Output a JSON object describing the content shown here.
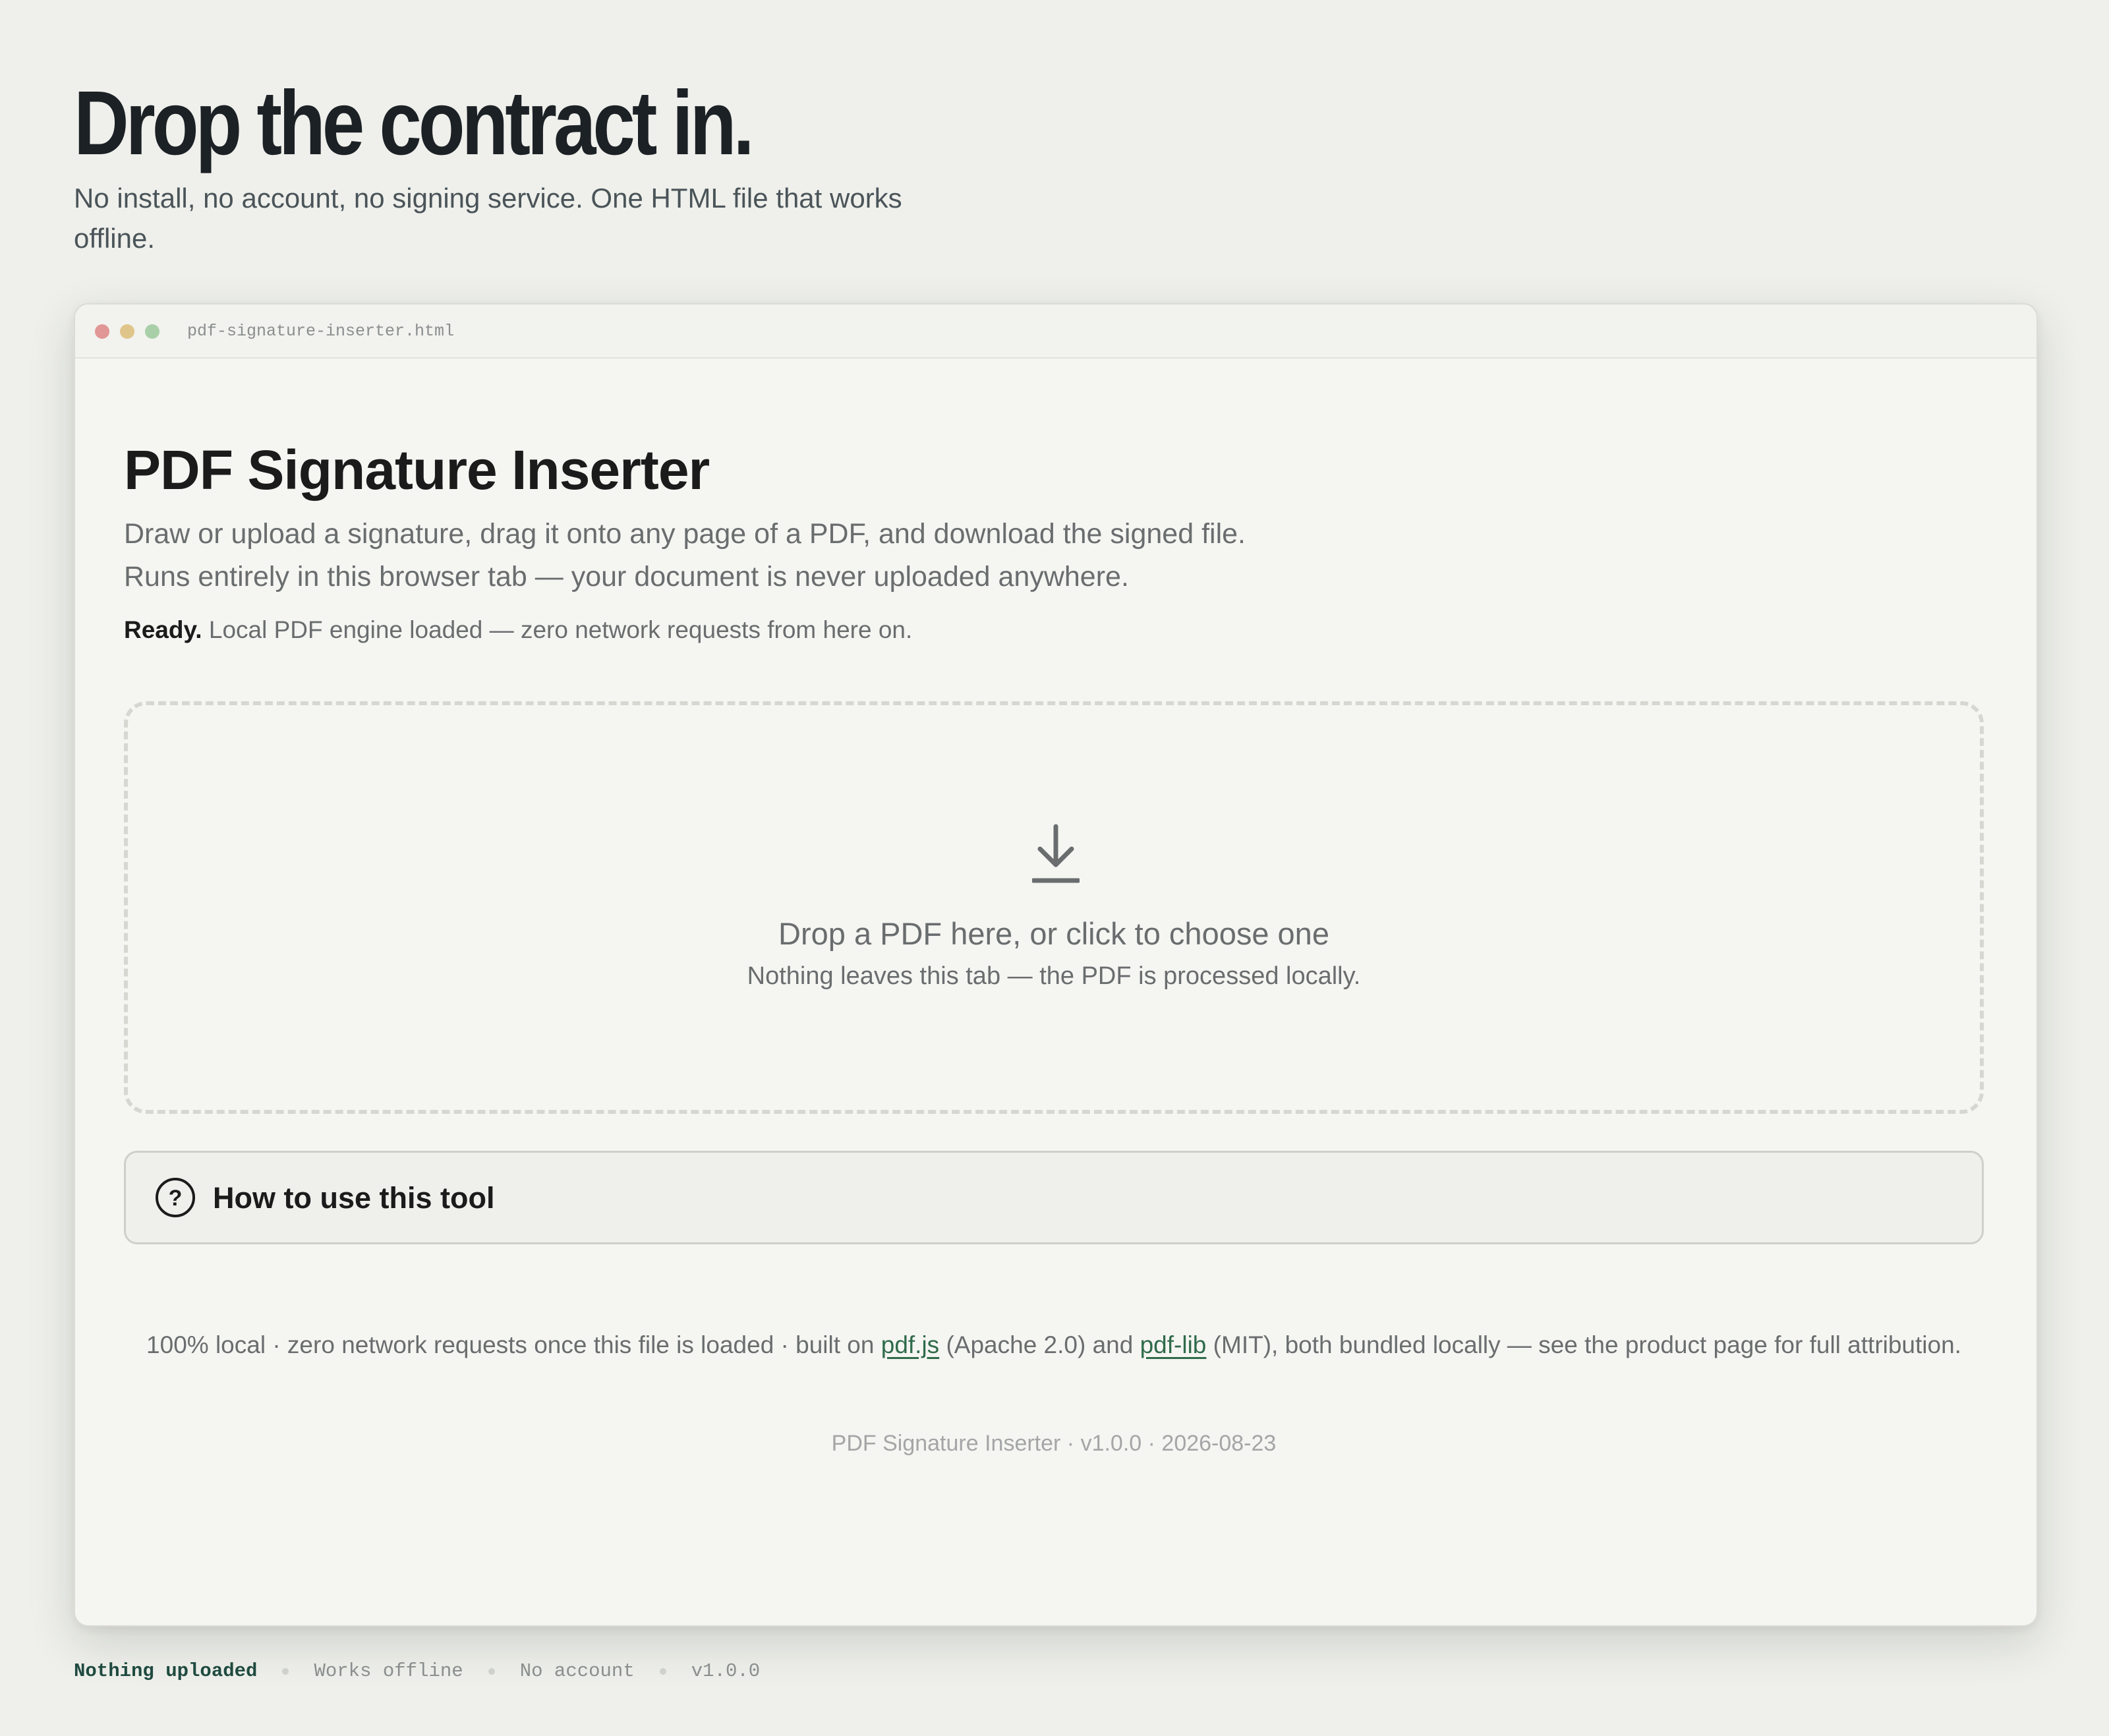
{
  "hero": {
    "title": "Drop the contract in.",
    "subtitle": "No install, no account, no signing service. One HTML file that works offline."
  },
  "window": {
    "filename": "pdf-signature-inserter.html"
  },
  "app": {
    "title": "PDF Signature Inserter",
    "description": "Draw or upload a signature, drag it onto any page of a PDF, and download the signed file. Runs entirely in this browser tab — your document is never uploaded anywhere.",
    "status_label": "Ready.",
    "status_text": " Local PDF engine loaded — zero network requests from here on."
  },
  "dropzone": {
    "icon": "download-icon",
    "title": "Drop a PDF here, or click to choose one",
    "subtitle": "Nothing leaves this tab — the PDF is processed locally."
  },
  "howto": {
    "icon": "help-icon",
    "label": "How to use this tool"
  },
  "footer": {
    "note_part1": "100% local · zero network requests once this file is loaded · built on ",
    "link1": "pdf.js",
    "note_part2": " (Apache 2.0) and ",
    "link2": "pdf-lib",
    "note_part3": " (MIT), both bundled locally — see the product page for full attribution.",
    "version_line": "PDF Signature Inserter · v1.0.0 · 2026-08-23"
  },
  "bottom_bar": {
    "items": [
      "Nothing uploaded",
      "Works offline",
      "No account",
      "v1.0.0"
    ]
  },
  "colors": {
    "accent": "#2f6b4a",
    "page_bg": "#eff0eb",
    "card_bg": "#f5f5f2",
    "dot_red": "#e19795",
    "dot_yellow": "#e0c58a",
    "dot_green": "#a9cfa9"
  }
}
